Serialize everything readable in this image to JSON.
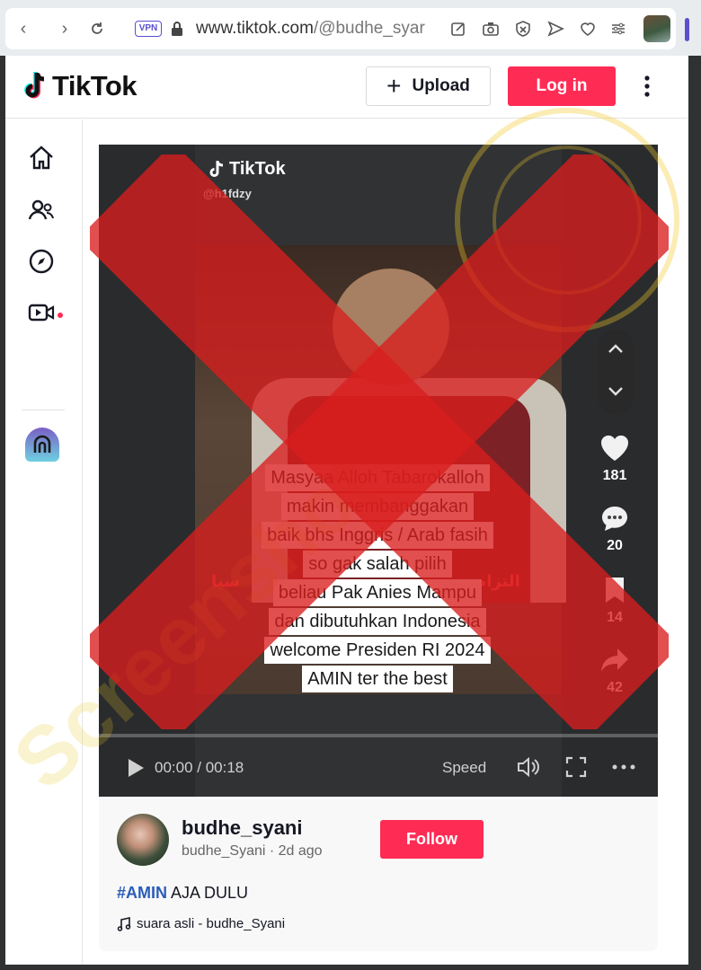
{
  "browser": {
    "vpn_label": "VPN",
    "url_host": "www.tiktok.com",
    "url_path": "/@budhe_syar"
  },
  "header": {
    "logo_text": "TikTok",
    "upload_label": "Upload",
    "login_label": "Log in"
  },
  "video": {
    "watermark_logo": "TikTok",
    "watermark_user": "@h1fdzy",
    "caption_lines": [
      "Masyaa Alloh Tabarokalloh",
      "makin membanggakan",
      "baik bhs Inggris / Arab fasih",
      "so gak salah pilih",
      "beliau Pak Anies Mampu",
      "dan dibutuhkan Indonesia",
      "welcome Presiden RI 2024",
      "AMIN ter the best"
    ],
    "arabic_left": "سيا",
    "arabic_right": "التزام",
    "likes": "181",
    "comments": "20",
    "saves": "14",
    "shares": "42",
    "time": "00:00 / 00:18",
    "speed_label": "Speed",
    "progress": 0
  },
  "author": {
    "username": "budhe_syani",
    "meta": "budhe_Syani · 2d ago",
    "follow_label": "Follow"
  },
  "post": {
    "hashtag": "#AMIN",
    "desc_rest": " AJA DULU",
    "music": "suara asli - budhe_Syani"
  },
  "colors": {
    "brand": "#fe2c55",
    "x_overlay": "#d81e1e",
    "stamp": "#f0c828"
  },
  "icons": [
    "home-icon",
    "following-icon",
    "explore-icon",
    "live-icon",
    "heart-icon",
    "comment-icon",
    "bookmark-icon",
    "share-icon"
  ]
}
